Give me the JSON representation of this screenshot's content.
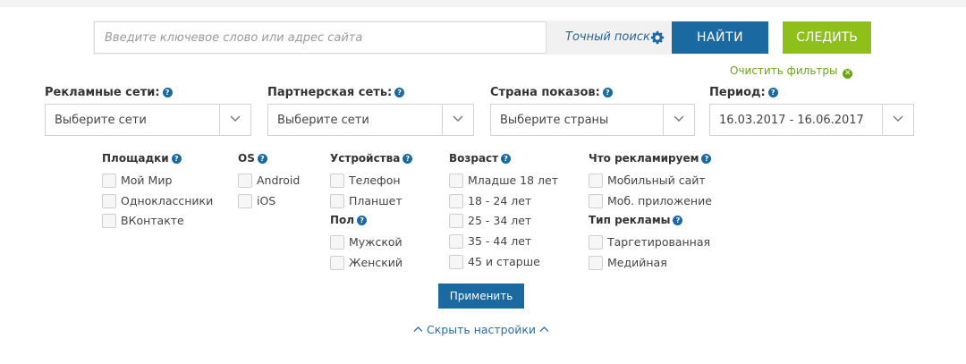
{
  "search": {
    "placeholder": "Введите ключевое слово или адрес сайта",
    "exact_label": "Точный поиск",
    "find_label": "НАЙТИ",
    "follow_label": "СЛЕДИТЬ"
  },
  "clear_filters": "Очистить фильтры",
  "filters": [
    {
      "label": "Рекламные сети:",
      "value": "Выберите сети"
    },
    {
      "label": "Партнерская сеть:",
      "value": "Выберите сети"
    },
    {
      "label": "Страна показов:",
      "value": "Выберите страны"
    },
    {
      "label": "Период:",
      "value": "16.03.2017 - 16.06.2017"
    }
  ],
  "groups": {
    "platforms": {
      "title": "Площадки",
      "items": [
        "Мой Мир",
        "Одноклассники",
        "ВКонтакте"
      ]
    },
    "os": {
      "title": "OS",
      "items": [
        "Android",
        "iOS"
      ]
    },
    "devices": {
      "title": "Устройства",
      "items": [
        "Телефон",
        "Планшет"
      ]
    },
    "gender": {
      "title": "Пол",
      "items": [
        "Мужской",
        "Женский"
      ]
    },
    "age": {
      "title": "Возраст",
      "items": [
        "Младше 18 лет",
        "18 - 24 лет",
        "25 - 34 лет",
        "35 - 44 лет",
        "45 и старше"
      ]
    },
    "advertise": {
      "title": "Что рекламируем",
      "items": [
        "Мобильный сайт",
        "Моб. приложение"
      ]
    },
    "ad_type": {
      "title": "Тип рекламы",
      "items": [
        "Таргетированная",
        "Медийная"
      ]
    }
  },
  "apply_label": "Применить",
  "hide_settings": "Скрыть настройки",
  "icons": {
    "gear": "gear-icon",
    "help": "help-icon",
    "clear": "close-circle-icon",
    "chevron": "chevron-down-icon",
    "chevron_up": "chevron-up-icon"
  },
  "colors": {
    "primary": "#1b69a1",
    "green": "#8ebf1b",
    "link_green": "#6aa417"
  }
}
